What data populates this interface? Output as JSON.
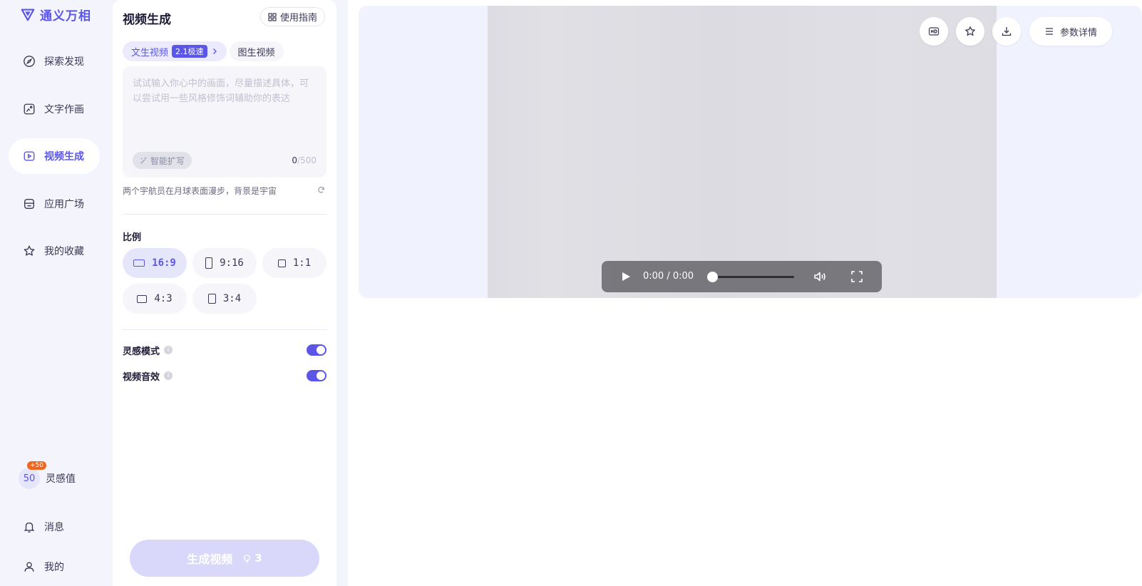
{
  "app": {
    "logo_text": "通义万相"
  },
  "nav": {
    "items": [
      {
        "label": "探索发现",
        "icon": "compass-icon"
      },
      {
        "label": "文字作画",
        "icon": "image-edit-icon"
      },
      {
        "label": "视频生成",
        "icon": "video-play-icon",
        "active": true
      },
      {
        "label": "应用广场",
        "icon": "store-icon"
      },
      {
        "label": "我的收藏",
        "icon": "star-icon"
      }
    ],
    "points": {
      "value": "50",
      "badge": "+50",
      "label": "灵感值"
    },
    "messages_label": "消息",
    "profile_label": "我的"
  },
  "panel": {
    "title": "视频生成",
    "guide_label": "使用指南",
    "tabs": [
      {
        "label": "文生视频",
        "speed": "2.1极速",
        "active": true
      },
      {
        "label": "图生视频"
      }
    ],
    "prompt": {
      "value": "",
      "placeholder": "试试输入你心中的画面，尽量描述具体，可以尝试用一些风格修饰词辅助你的表达",
      "expand_label": "智能扩写",
      "count": "0",
      "max": "/500"
    },
    "suggestion": "两个宇航员在月球表面漫步，背景是宇宙",
    "ratio_label": "比例",
    "ratios": [
      {
        "label": "16:9",
        "active": true
      },
      {
        "label": "9:16"
      },
      {
        "label": "1:1"
      },
      {
        "label": "4:3"
      },
      {
        "label": "3:4"
      }
    ],
    "toggles": [
      {
        "label": "灵感模式",
        "on": true
      },
      {
        "label": "视频音效",
        "on": true
      }
    ],
    "generate": {
      "label": "生成视频",
      "cost": "3"
    }
  },
  "player": {
    "current_time": "0:00",
    "separator": "/",
    "duration": "0:00",
    "progress": 0,
    "params_label": "参数详情"
  },
  "colors": {
    "accent": "#5b56e8",
    "badge": "#f0661e"
  }
}
